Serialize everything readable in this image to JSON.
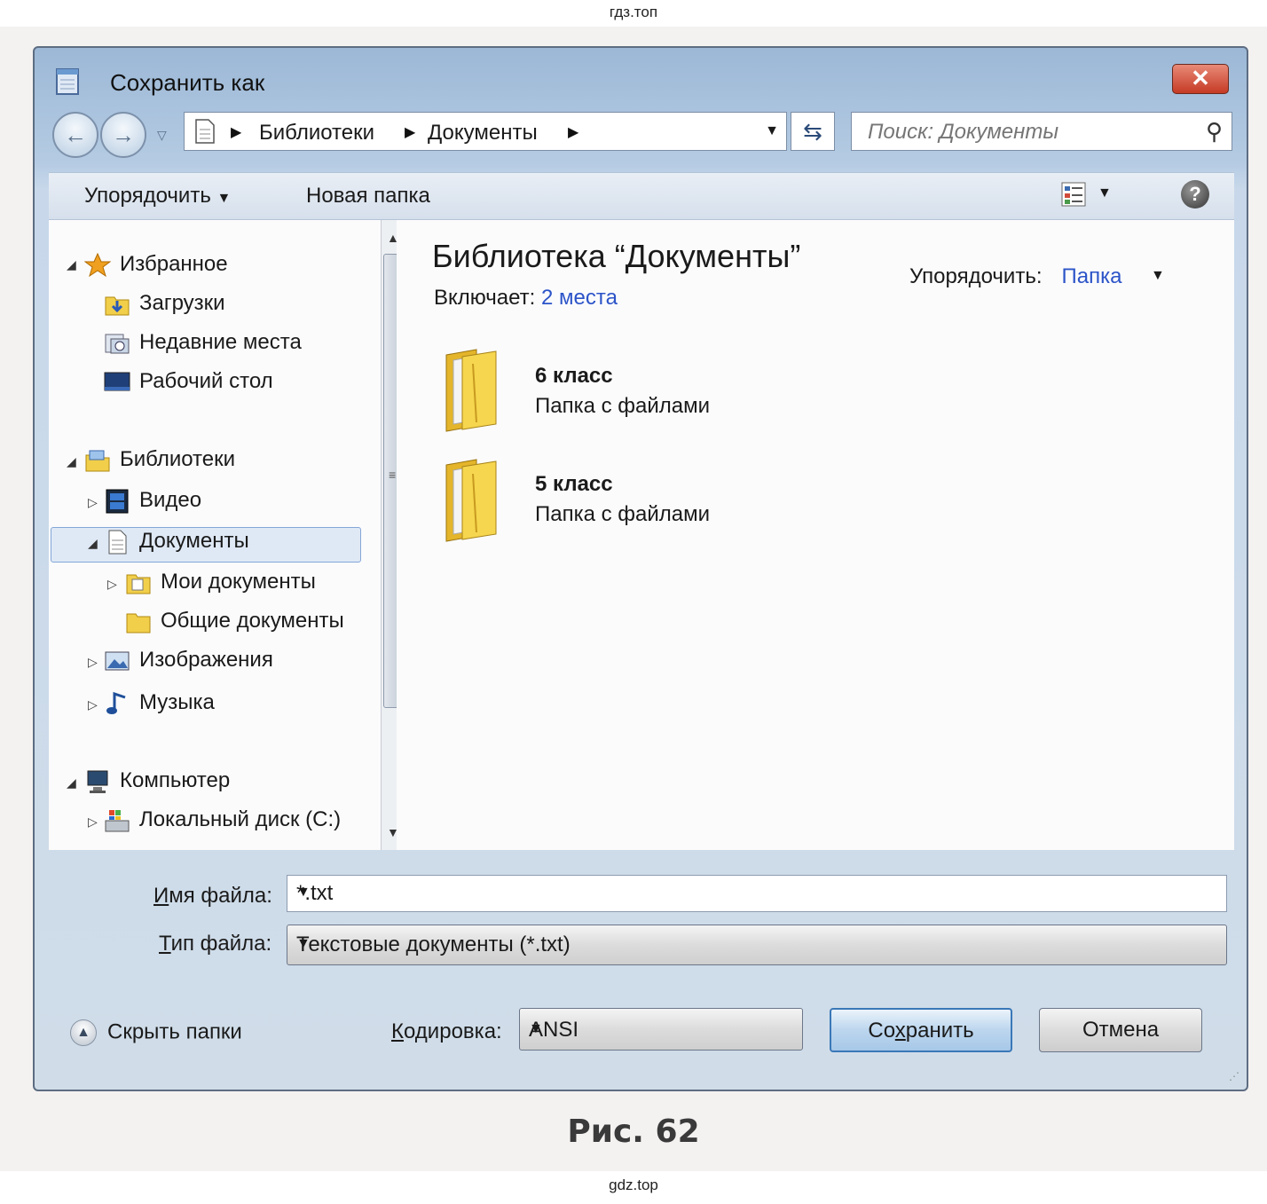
{
  "watermarks": {
    "top": "гдз.топ",
    "bottom": "gdz.top"
  },
  "caption": "Рис. 62",
  "window": {
    "title": "Сохранить как",
    "close_label": "✕"
  },
  "address": {
    "crumbs": [
      "Библиотеки",
      "Документы"
    ],
    "search_placeholder": "Поиск: Документы"
  },
  "toolbar": {
    "organize": "Упорядочить",
    "new_folder": "Новая папка",
    "help": "?"
  },
  "nav": {
    "favorites": "Избранное",
    "downloads": "Загрузки",
    "recent": "Недавние места",
    "desktop": "Рабочий стол",
    "libraries": "Библиотеки",
    "video": "Видео",
    "documents": "Документы",
    "my_documents": "Мои документы",
    "public_documents": "Общие документы",
    "images": "Изображения",
    "music": "Музыка",
    "computer": "Компьютер",
    "local_disk": "Локальный диск (C:)"
  },
  "content": {
    "title": "Библиотека “Документы”",
    "includes_label": "Включает:",
    "includes_link": "2 места",
    "arrange_label": "Упорядочить:",
    "arrange_value": "Папка",
    "folders": [
      {
        "name": "6 класс",
        "type": "Папка с файлами"
      },
      {
        "name": "5 класс",
        "type": "Папка с файлами"
      }
    ]
  },
  "fields": {
    "filename_label_first": "И",
    "filename_label_rest": "мя файла:",
    "filename_value": "*.txt",
    "filetype_label_first": "Т",
    "filetype_label_rest": "ип файла:",
    "filetype_value": "Текстовые документы (*.txt)",
    "encoding_label_first": "К",
    "encoding_label_rest": "одировка:",
    "encoding_value": "ANSI"
  },
  "buttons": {
    "hide_folders": "Скрыть папки",
    "save_first": "Со",
    "save_underlined": "х",
    "save_rest": "ранить",
    "cancel": "Отмена"
  },
  "colors": {
    "link": "#2c54c8",
    "selection": "#dfe9f6",
    "title_bar": "#9cb8d6",
    "close": "#c53a24"
  }
}
